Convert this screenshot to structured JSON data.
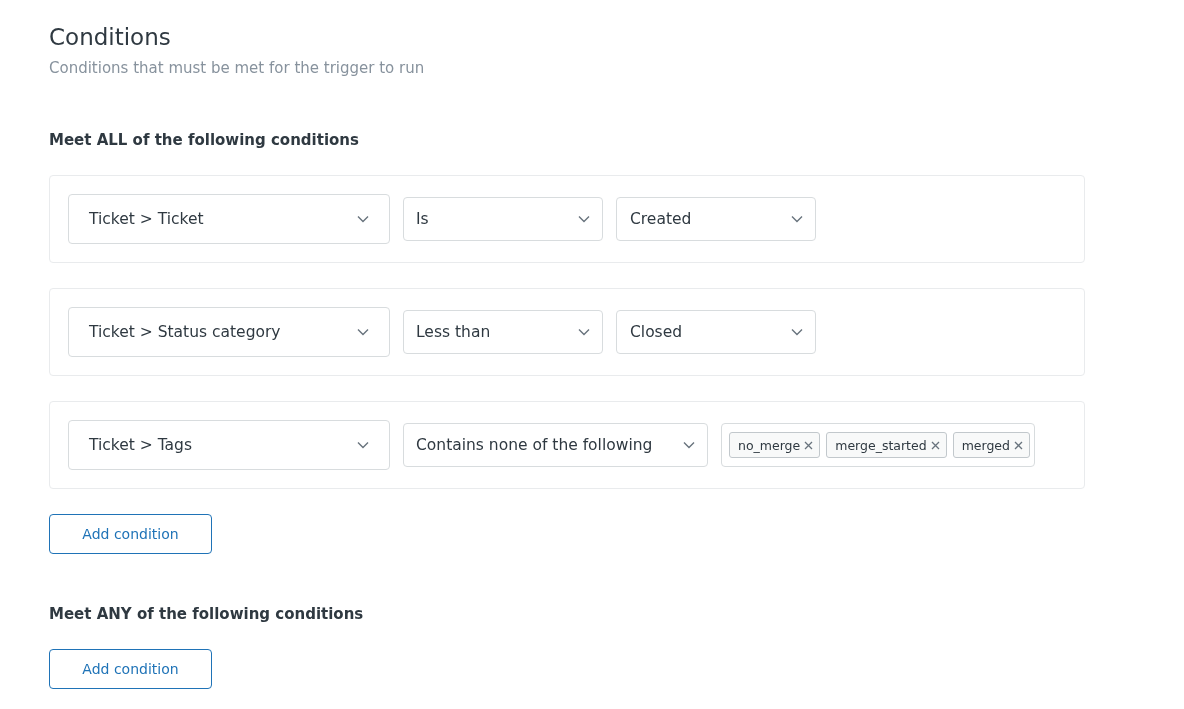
{
  "header": {
    "title": "Conditions",
    "subtitle": "Conditions that must be met for the trigger to run"
  },
  "groups": [
    {
      "heading": "Meet ALL of the following conditions",
      "conditions": [
        {
          "field": "Ticket > Ticket",
          "operator": "Is",
          "kind": "select",
          "value": "Created"
        },
        {
          "field": "Ticket > Status category",
          "operator": "Less than",
          "kind": "select",
          "value": "Closed"
        },
        {
          "field": "Ticket > Tags",
          "operator": "Contains none of the following",
          "kind": "tags",
          "tags": [
            "no_merge",
            "merge_started",
            "merged"
          ]
        }
      ],
      "add_button": "Add condition"
    },
    {
      "heading": "Meet ANY of the following conditions",
      "add_button": "Add condition"
    }
  ]
}
